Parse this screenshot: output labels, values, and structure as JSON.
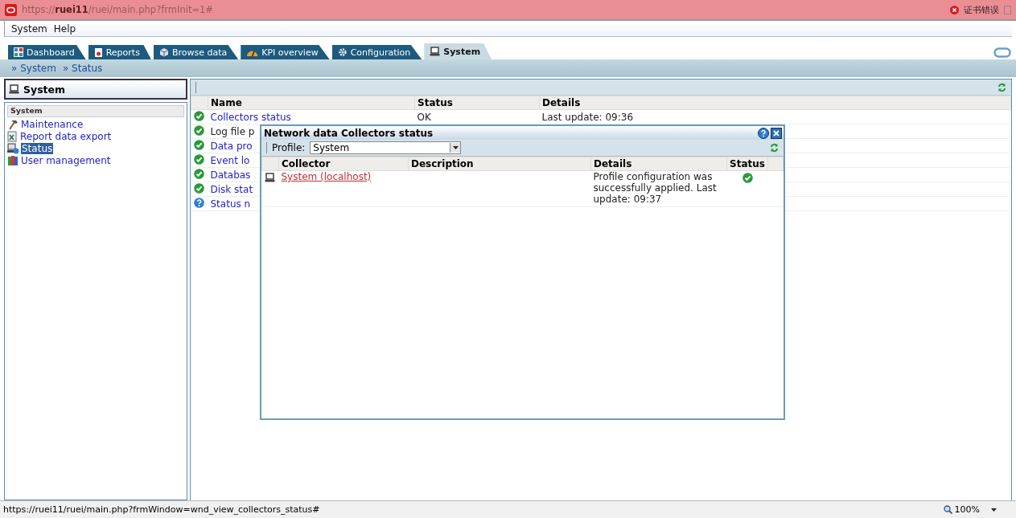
{
  "address_bar": {
    "url_prefix": "https://",
    "url_host": "ruei11",
    "url_path": "/ruei/main.php?frmInit=1#",
    "certificate_error": "证书错误"
  },
  "menu": [
    "System",
    "Help"
  ],
  "tabs": [
    {
      "label": "Dashboard",
      "selected": false
    },
    {
      "label": "Reports",
      "selected": false
    },
    {
      "label": "Browse data",
      "selected": false
    },
    {
      "label": "KPI overview",
      "selected": false
    },
    {
      "label": "Configuration",
      "selected": false
    },
    {
      "label": "System",
      "selected": true
    }
  ],
  "breadcrumb": [
    "» System",
    "» Status"
  ],
  "sidebar": {
    "title": "System",
    "section": "System",
    "items": [
      {
        "label": "Maintenance",
        "selected": false
      },
      {
        "label": "Report data export",
        "selected": false
      },
      {
        "label": "Status",
        "selected": true
      },
      {
        "label": "User management",
        "selected": false
      }
    ]
  },
  "status_table": {
    "columns": [
      "Name",
      "Status",
      "Details"
    ],
    "rows": [
      {
        "name": "Collectors status",
        "status": "OK",
        "details": "Last update: 09:36",
        "kind": "ok",
        "link": true
      },
      {
        "name": "Log file p",
        "kind": "ok",
        "link": false
      },
      {
        "name": "Data pro",
        "kind": "ok",
        "link": true
      },
      {
        "name": "Event lo",
        "kind": "ok",
        "link": true
      },
      {
        "name": "Databas",
        "kind": "ok",
        "link": true
      },
      {
        "name": "Disk stat",
        "kind": "ok",
        "link": true
      },
      {
        "name": "Status n",
        "kind": "unknown",
        "link": true
      }
    ]
  },
  "dialog": {
    "title": "Network data Collectors status",
    "profile_label": "Profile:",
    "profile_value": "System",
    "columns": [
      "Collector",
      "Description",
      "Details",
      "Status"
    ],
    "rows": [
      {
        "collector": "System (localhost)",
        "details": "Profile configuration was successfully applied. Last update: 09:37",
        "kind": "ok"
      }
    ]
  },
  "status_bar": {
    "url": "https://ruei11/ruei/main.php?frmWindow=wnd_view_collectors_status#",
    "zoom": "100%"
  }
}
